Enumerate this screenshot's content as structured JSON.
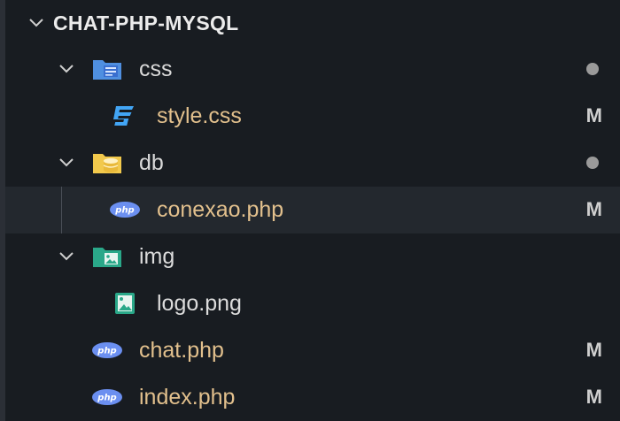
{
  "explorer": {
    "title": "CHAT-PHP-MYSQL",
    "title_icon": "chevron-down-icon",
    "items": [
      {
        "label": "css",
        "type": "folder",
        "icon": "css-folder-icon",
        "expanded": true,
        "status": "dot"
      },
      {
        "label": "style.css",
        "type": "file",
        "icon": "css3-file-icon",
        "status": "M"
      },
      {
        "label": "db",
        "type": "folder",
        "icon": "database-folder-icon",
        "expanded": true,
        "status": "dot"
      },
      {
        "label": "conexao.php",
        "type": "file",
        "icon": "php-file-icon",
        "status": "M",
        "selected": true
      },
      {
        "label": "img",
        "type": "folder",
        "icon": "image-folder-icon",
        "expanded": true,
        "status": ""
      },
      {
        "label": "logo.png",
        "type": "file",
        "icon": "image-file-icon",
        "status": ""
      },
      {
        "label": "chat.php",
        "type": "file",
        "icon": "php-file-icon",
        "status": "M"
      },
      {
        "label": "index.php",
        "type": "file",
        "icon": "php-file-icon",
        "status": "M"
      }
    ]
  },
  "colors": {
    "background": "#181c21",
    "selected_row": "#23282e",
    "modified_text": "#e2c08d",
    "php_icon": "#6b8ff0",
    "css_icon": "#42a5f5",
    "folder_blue": "#4f8fe0",
    "folder_yellow": "#f2c94c",
    "folder_teal": "#2aa889"
  }
}
